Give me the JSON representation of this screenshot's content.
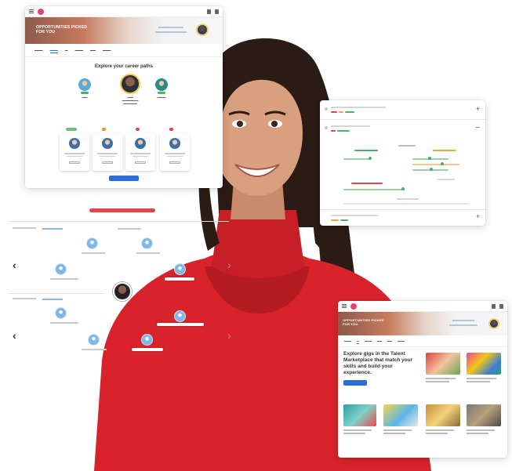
{
  "card_career": {
    "banner_title": "OPPORTUNITIES PICKED FOR YOU",
    "heading": "Explore your career paths",
    "button_label": ""
  },
  "card_gigs": {
    "banner_title": "OPPORTUNITIES PICKED FOR YOU",
    "description": "Explore gigs in the Talent Marketplace that match your skills and build your experience.",
    "button_label": ""
  },
  "colors": {
    "accent_blue": "#2b6fd6",
    "sweater_red": "#d8232a",
    "progress_red": "#e04548",
    "status_green": "#47b36b",
    "status_orange": "#f0a33a"
  },
  "icons": [
    "hamburger-icon",
    "logo-icon",
    "chevron-left-icon",
    "chevron-right-icon",
    "plus-icon",
    "minus-icon"
  ]
}
